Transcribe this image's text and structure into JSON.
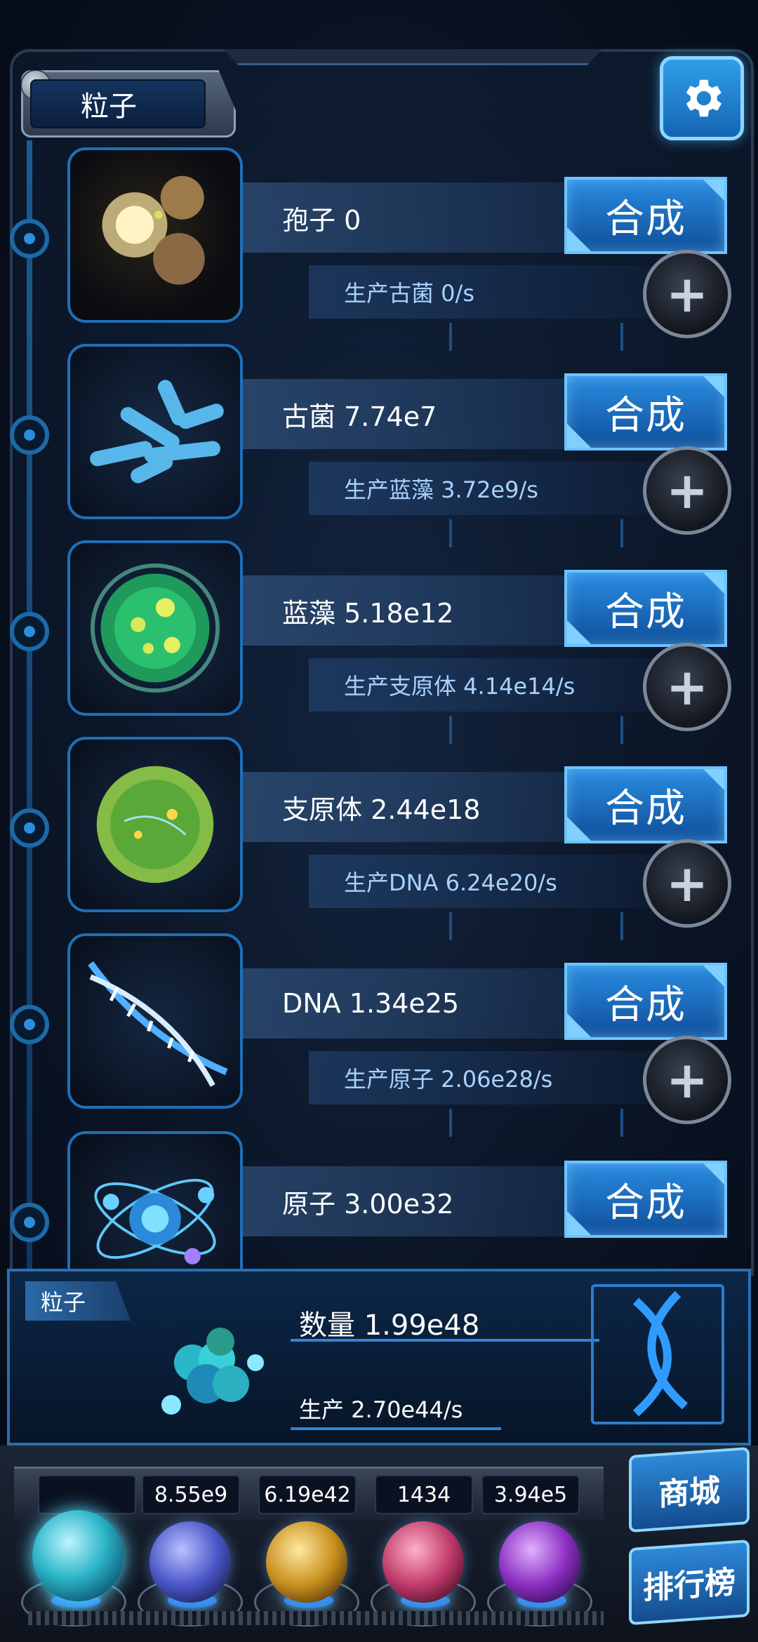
{
  "header": {
    "tab_title": "粒子",
    "settings_icon": "gear-icon"
  },
  "synth_label": "合成",
  "items": [
    {
      "name_text": "孢子 0",
      "prod_text": "生产古菌 0/s",
      "icon": "spore-icon"
    },
    {
      "name_text": "古菌 7.74e7",
      "prod_text": "生产蓝藻 3.72e9/s",
      "icon": "archaea-icon"
    },
    {
      "name_text": "蓝藻 5.18e12",
      "prod_text": "生产支原体 4.14e14/s",
      "icon": "cyanobacteria-icon"
    },
    {
      "name_text": "支原体 2.44e18",
      "prod_text": "生产DNA 6.24e20/s",
      "icon": "mycoplasma-icon"
    },
    {
      "name_text": "DNA 1.34e25",
      "prod_text": "生产原子 2.06e28/s",
      "icon": "dna-icon"
    },
    {
      "name_text": "原子 3.00e32",
      "prod_text": "",
      "icon": "atom-icon"
    }
  ],
  "panel": {
    "tag": "粒子",
    "quantity_text": "数量 1.99e48",
    "production_text": "生产 2.70e44/s"
  },
  "resources": [
    {
      "value": "",
      "icon": "particle-orb-icon",
      "color": "#2bb6c8"
    },
    {
      "value": "8.55e9",
      "icon": "lightning-orb-icon",
      "color": "#4a56c8"
    },
    {
      "value": "6.19e42",
      "icon": "galaxy-orb-icon",
      "color": "#c8901e"
    },
    {
      "value": "1434",
      "icon": "brain-orb-icon",
      "color": "#c03a6a"
    },
    {
      "value": "3.94e5",
      "icon": "vortex-orb-icon",
      "color": "#8a2ec0"
    }
  ],
  "side_buttons": {
    "shop_label": "商城",
    "rank_label": "排行榜"
  }
}
